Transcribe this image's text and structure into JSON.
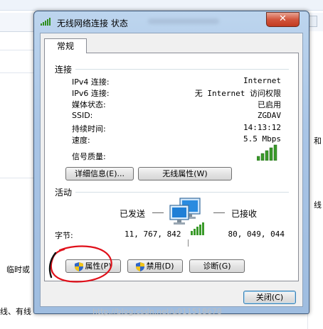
{
  "background": {
    "left_texts": [
      "临时或",
      "线、有线"
    ],
    "right_texts": [
      "和",
      "线"
    ]
  },
  "dialog": {
    "title": "无线网络连接 状态",
    "close_glyph": "✕",
    "tab_general": "常规",
    "connection": {
      "heading": "连接",
      "rows": [
        {
          "label": "IPv4 连接:",
          "value": "Internet"
        },
        {
          "label": "IPv6 连接:",
          "value": "无 Internet 访问权限"
        },
        {
          "label": "媒体状态:",
          "value": "已启用"
        },
        {
          "label": "SSID:",
          "value": "ZGDAV"
        },
        {
          "label": "持续时间:",
          "value": "14:13:12"
        },
        {
          "label": "速度:",
          "value": "5.5 Mbps"
        }
      ],
      "signal_label": "信号质量:",
      "signal_bars": 5,
      "details_button": "详细信息(E)...",
      "wireless_props_button": "无线属性(W)"
    },
    "activity": {
      "heading": "活动",
      "sent_label": "已发送",
      "received_label": "已接收",
      "bytes_label": "字节:",
      "bytes_sent": "11, 767, 842",
      "bytes_received": "80, 049, 044"
    },
    "buttons": {
      "properties": "属性(P)",
      "disable": "禁用(D)",
      "diagnose": "诊断(G)",
      "close": "关闭(C)"
    }
  },
  "colors": {
    "signal_green": "#3a9a2a",
    "annotation_red": "#e0101a",
    "title_gradient_top": "#bdd5ee",
    "close_red": "#c23b21"
  },
  "icons": [
    "signal-bars-icon",
    "network-computers-icon",
    "uac-shield-icon"
  ]
}
